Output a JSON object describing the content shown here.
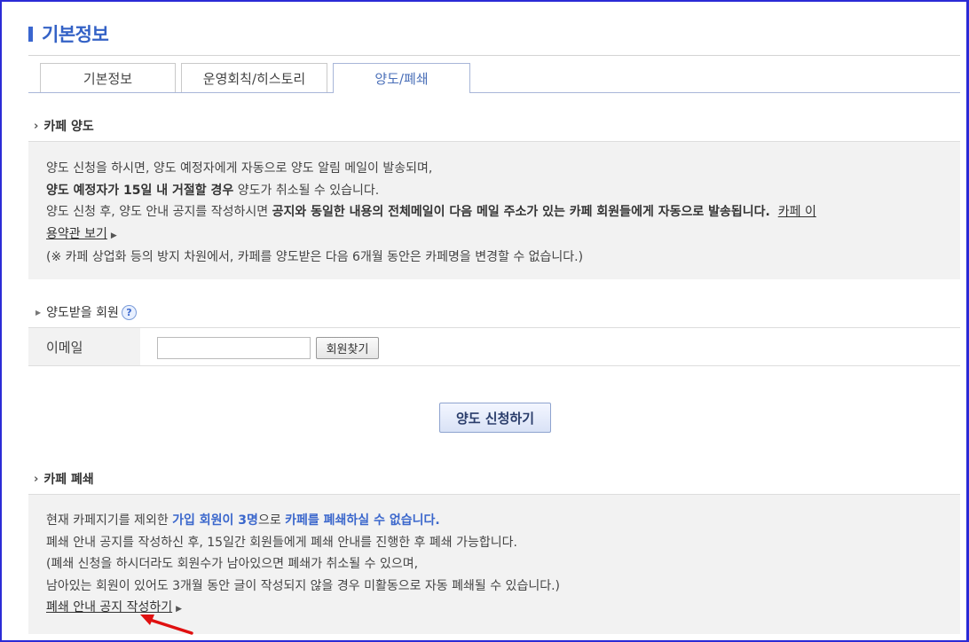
{
  "page_title": "기본정보",
  "tabs": [
    {
      "label": "기본정보"
    },
    {
      "label": "운영회칙/히스토리"
    },
    {
      "label": "양도/폐쇄"
    }
  ],
  "transfer": {
    "heading": "카페 양도",
    "line1": "양도 신청을 하시면, 양도 예정자에게 자동으로 양도 알림 메일이 발송되며,",
    "line2_bold": "양도 예정자가 15일 내 거절할 경우",
    "line2_rest": " 양도가 취소될 수 있습니다.",
    "line3_start": "양도 신청 후, 양도 안내 공지를 작성하시면 ",
    "line3_bold": "공지와 동일한 내용의 전체메일이 다음 메일 주소가 있는 카페 회원들에게 자동으로 발송됩니다.",
    "terms_link_part1": "카페 이",
    "terms_link_part2": "용약관 보기",
    "line5": "(※ 카페 상업화 등의 방지 차원에서, 카페를 양도받은 다음 6개월 동안은 카페명을 변경할 수 없습니다.)"
  },
  "recipient": {
    "heading": "양도받을 회원",
    "help_glyph": "?",
    "email_label": "이메일",
    "email_value": "",
    "find_button": "회원찾기"
  },
  "apply_button": "양도 신청하기",
  "closure": {
    "heading": "카페 폐쇄",
    "line1_start": "현재 카페지기를 제외한 ",
    "line1_highlight1": "가입 회원이 3명",
    "line1_mid": "으로 ",
    "line1_highlight2": "카페를 폐쇄하실 수 없습니다.",
    "line2": "폐쇄 안내 공지를 작성하신 후, 15일간 회원들에게 폐쇄 안내를 진행한 후 폐쇄 가능합니다.",
    "line3": "(폐쇄 신청을 하시더라도 회원수가 남아있으면 폐쇄가 취소될 수 있으며,",
    "line4": "남아있는 회원이 있어도 3개월 동안 글이 작성되지 않을 경우 미활동으로 자동 폐쇄될 수 있습니다.)",
    "notice_link": "폐쇄 안내 공지 작성하기"
  },
  "colors": {
    "accent": "#3462c6",
    "frame": "#2b2bd6",
    "arrow": "#e01010"
  }
}
